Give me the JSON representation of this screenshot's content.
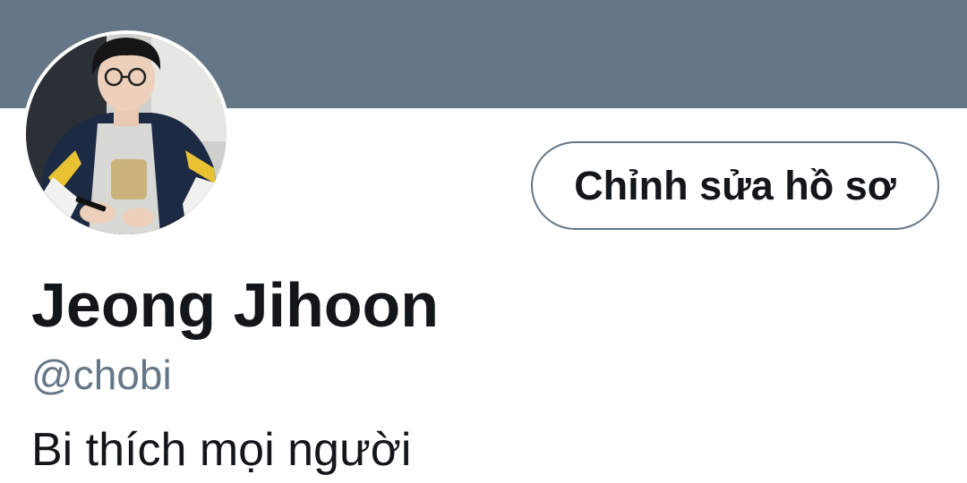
{
  "profile": {
    "display_name": "Jeong Jihoon",
    "handle": "@chobi",
    "bio": "Bi thích mọi người",
    "edit_profile_label": "Chỉnh sửa hồ sơ"
  },
  "colors": {
    "banner": "#657786",
    "text_primary": "#14171a",
    "text_secondary": "#657786",
    "button_border": "#657786"
  },
  "icons": {
    "avatar": "profile-photo"
  }
}
